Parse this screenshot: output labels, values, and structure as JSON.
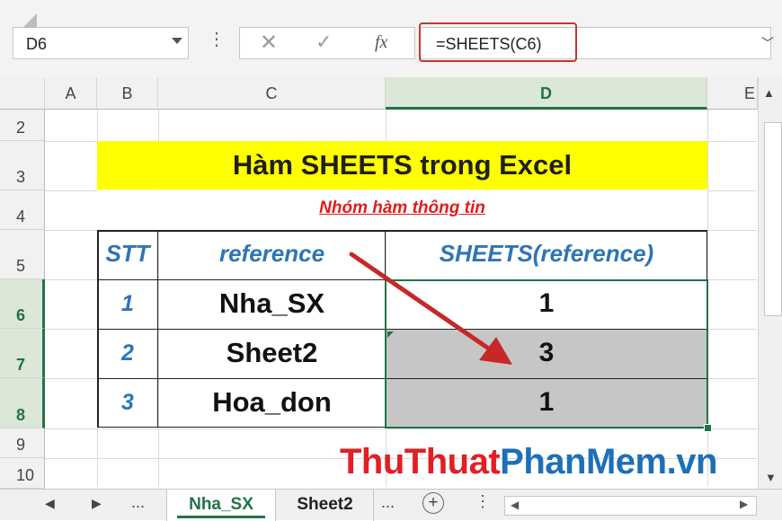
{
  "formula_bar": {
    "name_box": "D6",
    "separator_icon": "vertical-ellipsis",
    "cancel_icon": "close-icon",
    "enter_icon": "check-icon",
    "fx_label": "fx",
    "formula": "=SHEETS(C6)",
    "highlight_color": "#c0392b"
  },
  "columns": [
    "A",
    "B",
    "C",
    "D",
    "E"
  ],
  "rows": [
    "2",
    "3",
    "4",
    "5",
    "6",
    "7",
    "8",
    "9",
    "10"
  ],
  "sheet": {
    "title": "Hàm SHEETS trong Excel",
    "subtitle": "Nhóm hàm thông tin",
    "title_bg": "#ffff00",
    "subtitle_color": "#e31b1b",
    "table": {
      "headers": [
        "STT",
        "reference",
        "SHEETS(reference)"
      ],
      "rows": [
        {
          "stt": "1",
          "reference": "Nha_SX",
          "result": "1"
        },
        {
          "stt": "2",
          "reference": "Sheet2",
          "result": "3"
        },
        {
          "stt": "3",
          "reference": "Hoa_don",
          "result": "1"
        }
      ],
      "header_color": "#2e75b6"
    }
  },
  "tabs": {
    "nav_more": "...",
    "items": [
      "Nha_SX",
      "Sheet2"
    ],
    "active": "Nha_SX",
    "more": "...",
    "add_icon": "plus-circle-icon",
    "accent": "#217346"
  },
  "watermark": {
    "part1": "ThuThuat",
    "part2": "PhanMem.vn"
  }
}
